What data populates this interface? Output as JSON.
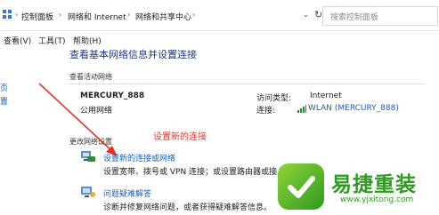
{
  "address": {
    "crumbs": [
      "控制面板",
      "网络和 Internet",
      "网络和共享中心"
    ],
    "search_placeholder": "搜索控制面板"
  },
  "menu": {
    "items": [
      "查看(V)",
      "工具(T)",
      "帮助(H)"
    ]
  },
  "nav": {
    "fragments": [
      "页",
      "置"
    ]
  },
  "main": {
    "heading": "查看基本网络信息并设置连接",
    "active_section": "查看活动网络",
    "network_name": "MERCURY_888",
    "network_type": "公用网络",
    "access_type_label": "访问类型:",
    "access_type_value": "Internet",
    "connection_label": "连接:",
    "connection_value": "WLAN (MERCURY_888)",
    "change_section": "更改网络设置",
    "setup_link": "设置新的连接或网络",
    "setup_desc": "设置宽带、拨号或 VPN 连接；或设置路由器或接入",
    "trouble_link": "问题疑难解答",
    "trouble_desc": "诊断并修复网络问题，或者获得疑难解答信息。"
  },
  "annotation": {
    "text": "设置新的连接"
  },
  "watermark": {
    "title": "易捷重装",
    "url": "www.yjxitong.com"
  },
  "colors": {
    "link": "#1a5fb4",
    "heading": "#1a3a8f",
    "annotation": "#e0342b",
    "watermark": "#2e9a1f"
  }
}
